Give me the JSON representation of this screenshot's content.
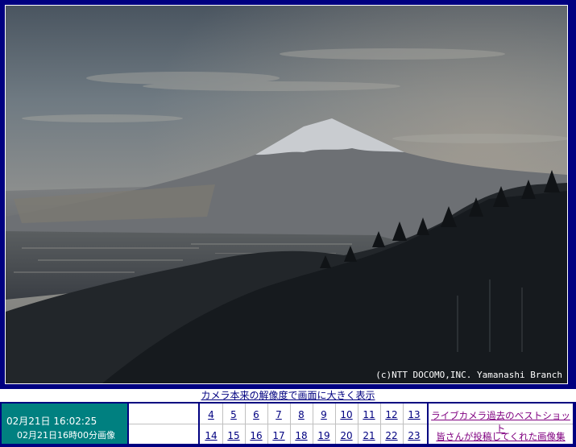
{
  "camera": {
    "copyright": "(c)NTT DOCOMO,INC. Yamanashi Branch",
    "enlarge_link": "カメラ本来の解像度で画面に大きく表示"
  },
  "timestamp": {
    "current": "02月21日 16:02:25",
    "image": "02月21日16時00分画像"
  },
  "hours": {
    "row1": [
      "4",
      "5",
      "6",
      "7",
      "8",
      "9",
      "10",
      "11",
      "12",
      "13"
    ],
    "row2": [
      "14",
      "15",
      "16",
      "17",
      "18",
      "19",
      "20",
      "21",
      "22",
      "23"
    ]
  },
  "links": {
    "best_shot": "ライブカメラ過去のベストショット",
    "user_posts": "皆さんが投稿してくれた画像集"
  },
  "colors": {
    "frame": "#000080",
    "stamp": "#008080",
    "link": "#000080",
    "visited_link": "#800080"
  }
}
